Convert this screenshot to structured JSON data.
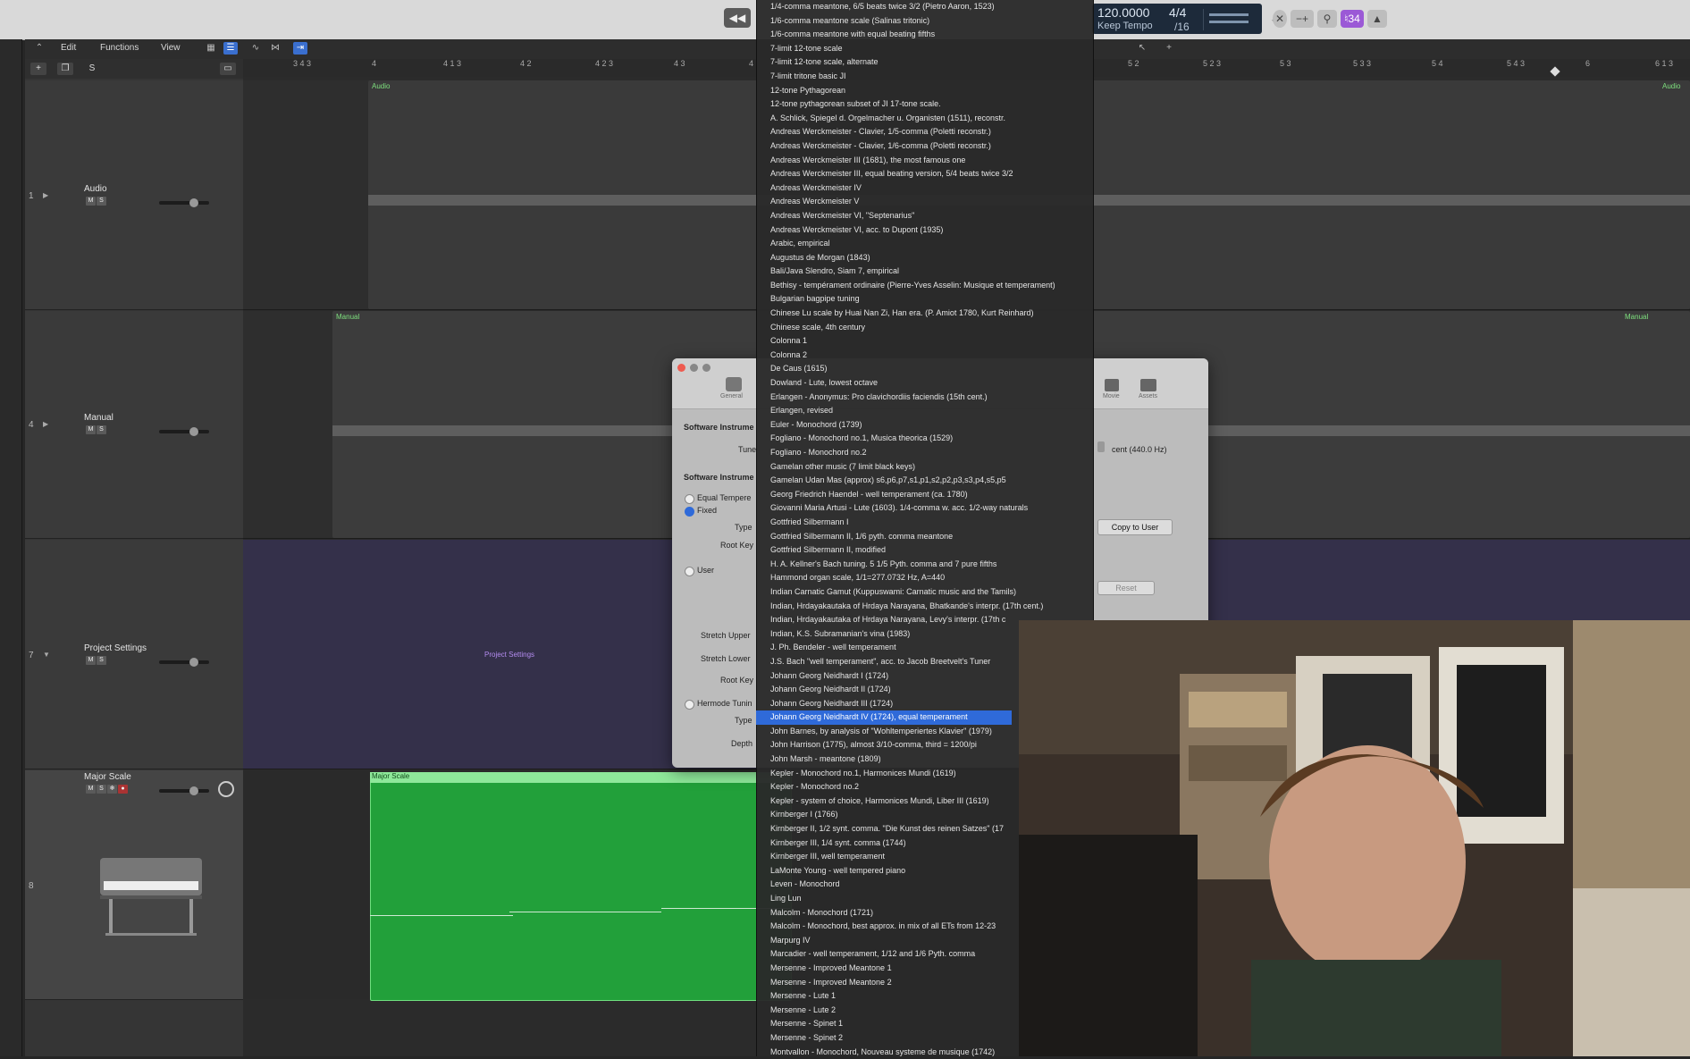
{
  "transport": {
    "tempo": "120.0000",
    "tempo_mode": "Keep Tempo",
    "time_sig": "4/4",
    "division": "/16",
    "key_badge": "♮34",
    "rewind_icon": "rewind-icon"
  },
  "editor": {
    "menus": [
      "Edit",
      "Functions",
      "View"
    ],
    "add_label": "+",
    "solo_label": "S"
  },
  "ruler": {
    "ticks": [
      "3 4 3",
      "4",
      "4 1 3",
      "4 2",
      "4 2 3",
      "4 3",
      "4",
      "5 2",
      "5 2 3",
      "5 3",
      "5 3 3",
      "5 4",
      "5 4 3",
      "6",
      "6 1 3"
    ]
  },
  "tracks": [
    {
      "num": "1",
      "name": "Audio",
      "region": "Audio",
      "region_right": "Audio"
    },
    {
      "num": "4",
      "name": "Manual",
      "region": "Manual",
      "region_right": "Manual"
    },
    {
      "num": "7",
      "name": "Project Settings",
      "region": "Project Settings"
    },
    {
      "num": "8",
      "name": "Major Scale",
      "region": "Major Scale"
    }
  ],
  "ms": {
    "m": "M",
    "s": "S"
  },
  "dialog": {
    "tab_general": "General",
    "tab_movie": "Movie",
    "tab_assets": "Assets",
    "sw_instrument_1": "Software Instrume",
    "tune": "Tune",
    "tune_value": "cent (440.0 Hz)",
    "sw_instrument_2": "Software Instrume",
    "equal_temper": "Equal Tempere",
    "fixed": "Fixed",
    "type": "Type",
    "root_key": "Root Key",
    "copy_to_user": "Copy to User",
    "user": "User",
    "reset": "Reset",
    "stretch_upper": "Stretch Upper",
    "stretch_lower": "Stretch Lower",
    "root_key_2": "Root Key",
    "hermode": "Hermode Tunin",
    "type_2": "Type",
    "depth": "Depth"
  },
  "tuning_menu": {
    "items": [
      "1/4-comma meantone, 6/5 beats twice 3/2 (Pietro Aaron, 1523)",
      "1/6-comma meantone scale (Salinas tritonic)",
      "1/6-comma meantone with equal beating fifths",
      "7-limit 12-tone scale",
      "7-limit 12-tone scale, alternate",
      "7-limit tritone basic JI",
      "12-tone Pythagorean",
      "12-tone pythagorean subset of JI 17-tone scale.",
      "A. Schlick, Spiegel d. Orgelmacher u. Organisten (1511), reconstr.",
      "Andreas Werckmeister - Clavier, 1/5-comma (Poletti reconstr.)",
      "Andreas Werckmeister - Clavier, 1/6-comma (Poletti reconstr.)",
      "Andreas Werckmeister III (1681), the most famous one",
      "Andreas Werckmeister III, equal beating version, 5/4 beats twice 3/2",
      "Andreas Werckmeister IV",
      "Andreas Werckmeister V",
      "Andreas Werckmeister VI, \"Septenarius\"",
      "Andreas Werckmeister VI, acc. to Dupont (1935)",
      "Arabic, empirical",
      "Augustus de Morgan (1843)",
      "Bali/Java Slendro, Siam 7, empirical",
      "Bethisy - tempérament ordinaire (Pierre-Yves Asselin: Musique et temperament)",
      "Bulgarian bagpipe tuning",
      "Chinese Lu scale by Huai Nan Zi, Han era. (P. Amiot 1780, Kurt Reinhard)",
      "Chinese scale, 4th century",
      "Colonna 1",
      "Colonna 2",
      "De Caus (1615)",
      "Dowland - Lute, lowest octave",
      "Erlangen - Anonymus: Pro clavichordiis faciendis (15th cent.)",
      "Erlangen, revised",
      "Euler - Monochord (1739)",
      "Fogliano - Monochord no.1, Musica theorica (1529)",
      "Fogliano - Monochord no.2",
      "Gamelan other music (7 limit black keys)",
      "Gamelan Udan Mas (approx) s6,p6,p7,s1,p1,s2,p2,p3,s3,p4,s5,p5",
      "Georg Friedrich Haendel - well temperament (ca. 1780)",
      "Giovanni Maria Artusi - Lute (1603). 1/4-comma w. acc. 1/2-way naturals",
      "Gottfried Silbermann I",
      "Gottfried Silbermann II, 1/6 pyth. comma meantone",
      "Gottfried Silbermann II, modified",
      "H. A. Kellner's Bach tuning. 5 1/5 Pyth. comma and 7 pure fifths",
      "Hammond organ scale, 1/1=277.0732 Hz, A=440",
      "Indian Carnatic Gamut (Kuppuswami: Carnatic music and the Tamils)",
      "Indian, Hrdayakautaka of Hrdaya Narayana, Bhatkande's interpr. (17th cent.)",
      "Indian, Hrdayakautaka of Hrdaya Narayana, Levy's interpr. (17th c",
      "Indian, K.S. Subramanian's vina (1983)",
      "J. Ph. Bendeler - well temperament",
      "J.S. Bach \"well temperament\", acc. to Jacob Breetvelt's Tuner",
      "Johann Georg Neidhardt I (1724)",
      "Johann Georg Neidhardt II (1724)",
      "Johann Georg Neidhardt III (1724)",
      "Johann Georg Neidhardt IV (1724), equal temperament",
      "John Barnes, by analysis of \"Wohltemperiertes Klavier\" (1979)",
      "John Harrison (1775), almost 3/10-comma, third = 1200/pi",
      "John Marsh - meantone (1809)",
      "Kepler - Monochord no.1, Harmonices Mundi (1619)",
      "Kepler - Monochord no.2",
      "Kepler - system of choice, Harmonices Mundi, Liber III (1619)",
      "Kirnberger I (1766)",
      "Kirnberger II, 1/2 synt. comma. \"Die Kunst des reinen Satzes\" (17",
      "Kirnberger III, 1/4 synt. comma (1744)",
      "Kirnberger III, well temperament",
      "LaMonte Young - well tempered piano",
      "Leven - Monochord",
      "Ling Lun",
      "Malcolm - Monochord (1721)",
      "Malcolm - Monochord, best approx. in mix of all ETs from 12-23",
      "Marpurg IV",
      "Marcadier - well temperament, 1/12 and 1/6 Pyth. comma",
      "Mersenne - Improved Meantone 1",
      "Mersenne - Improved Meantone 2",
      "Mersenne - Lute 1",
      "Mersenne - Lute 2",
      "Mersenne - Spinet 1",
      "Mersenne - Spinet 2",
      "Montvallon - Monochord, Nouveau systeme de musique (1742)"
    ],
    "selected_index": 51
  }
}
